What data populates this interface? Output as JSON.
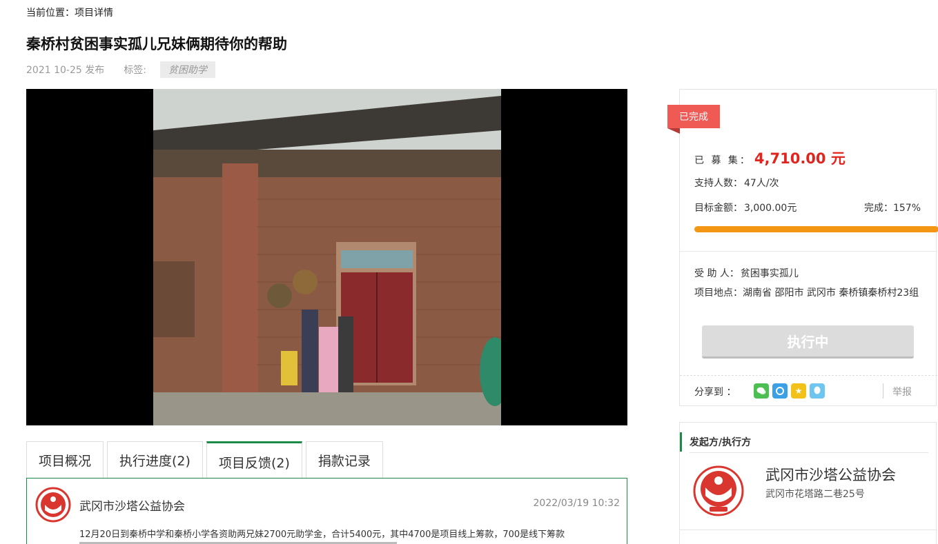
{
  "breadcrumb": "当前位置：项目详情",
  "title": "秦桥村贫困事实孤儿兄妹俩期待你的帮助",
  "meta": {
    "published": "2021 10-25 发布",
    "tags_label": "标签:",
    "tag": "贫困助学"
  },
  "tabs": [
    {
      "label": "项目概况"
    },
    {
      "label": "执行进度(2)"
    },
    {
      "label": "项目反馈(2)",
      "active": true
    },
    {
      "label": "捐款记录"
    }
  ],
  "feedback": {
    "org": "武冈市沙塔公益协会",
    "date": "2022/03/19    10:32",
    "text": "12月20日到秦桥中学和秦桥小学各资助两兄妹2700元助学金，合计5400元，其中4700是项目线上筹款，700是线下筹款"
  },
  "summary": {
    "status": "已完成",
    "raised_label": "已 募 集：",
    "raised_value": "4,710.00 元",
    "supporters_label": "支持人数：",
    "supporters_value": "47人/次",
    "target_label": "目标金额：",
    "target_value": "3,000.00元",
    "completion_label": "完成：",
    "completion_value": "157%",
    "progress_fraction": 1.0,
    "beneficiary_label": "受 助 人：",
    "beneficiary_value": "贫困事实孤儿",
    "location_label": "项目地点：",
    "location_value": "湖南省 邵阳市 武冈市 秦桥镇秦桥村23组",
    "button_label": "执行中",
    "share_label": "分享到   ：",
    "report_label": "举报",
    "colors": {
      "accent": "#e0251f",
      "progress": "#f39613",
      "ribbon": "#ef5a55",
      "green": "#1b8a46"
    }
  },
  "organizer": {
    "heading": "发起方/执行方",
    "name": "武冈市沙塔公益协会",
    "address": "武冈市花塔路二巷25号"
  }
}
